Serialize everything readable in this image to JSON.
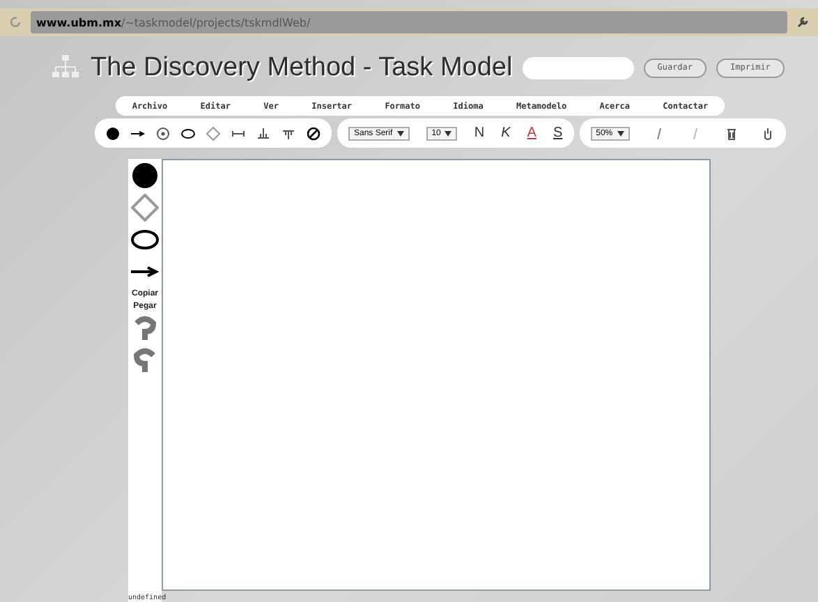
{
  "browser": {
    "url_host": "www.ubm.mx",
    "url_path": "/~taskmodel/projects/tskmdlWeb/"
  },
  "header": {
    "title": "The Discovery Method - Task Model",
    "buttons": [
      "Guardar",
      "Imprimir"
    ]
  },
  "menu": [
    "Archivo",
    "Editar",
    "Ver",
    "Insertar",
    "Formato",
    "Idioma",
    "Metamodelo",
    "Acerca",
    "Contactar"
  ],
  "shape_tools": [
    {
      "kind": "dot"
    },
    {
      "kind": "arrow"
    },
    {
      "kind": "circle"
    },
    {
      "kind": "ellipse"
    },
    {
      "kind": "diamond"
    },
    {
      "kind": "bar"
    },
    {
      "kind": "fork"
    },
    {
      "kind": "join"
    },
    {
      "kind": "none"
    }
  ],
  "format": {
    "font": "Sans Serif",
    "size": "10",
    "bold": "N",
    "italic": "K",
    "font_color_label": "A",
    "strike": "S"
  },
  "view": {
    "zoom": "50%"
  },
  "palette": [
    {
      "kind": "dot"
    },
    {
      "kind": "diamond"
    },
    {
      "kind": "ellipse"
    },
    {
      "kind": "arrow"
    },
    {
      "kind": "text",
      "label": "Copiar"
    },
    {
      "kind": "text",
      "label": "Pegar"
    },
    {
      "kind": "undo"
    },
    {
      "kind": "redo"
    }
  ],
  "status": "undefined"
}
